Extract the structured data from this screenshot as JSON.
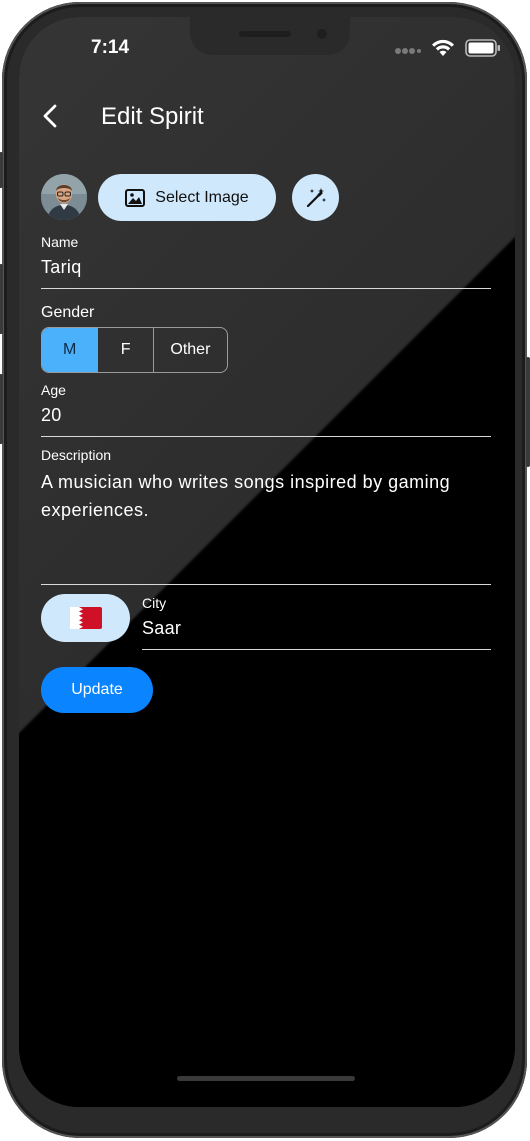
{
  "status": {
    "time": "7:14"
  },
  "header": {
    "title": "Edit Spirit"
  },
  "image": {
    "select_label": "Select Image"
  },
  "form": {
    "name_label": "Name",
    "name_value": "Tariq",
    "gender_label": "Gender",
    "gender_options": [
      "M",
      "F",
      "Other"
    ],
    "gender_selected": "M",
    "age_label": "Age",
    "age_value": "20",
    "description_label": "Description",
    "description_value": "A musician who writes songs inspired by gaming experiences.",
    "city_label": "City",
    "city_value": "Saar",
    "country_flag": "🇧🇭"
  },
  "actions": {
    "update_label": "Update"
  },
  "colors": {
    "accent": "#0a84ff",
    "pill_bg": "#cfe8fc",
    "segment_selected": "#4cb1fb"
  },
  "icons": [
    "back-arrow-icon",
    "image-icon",
    "magic-wand-icon",
    "wifi-icon",
    "battery-icon",
    "signal-icon"
  ]
}
